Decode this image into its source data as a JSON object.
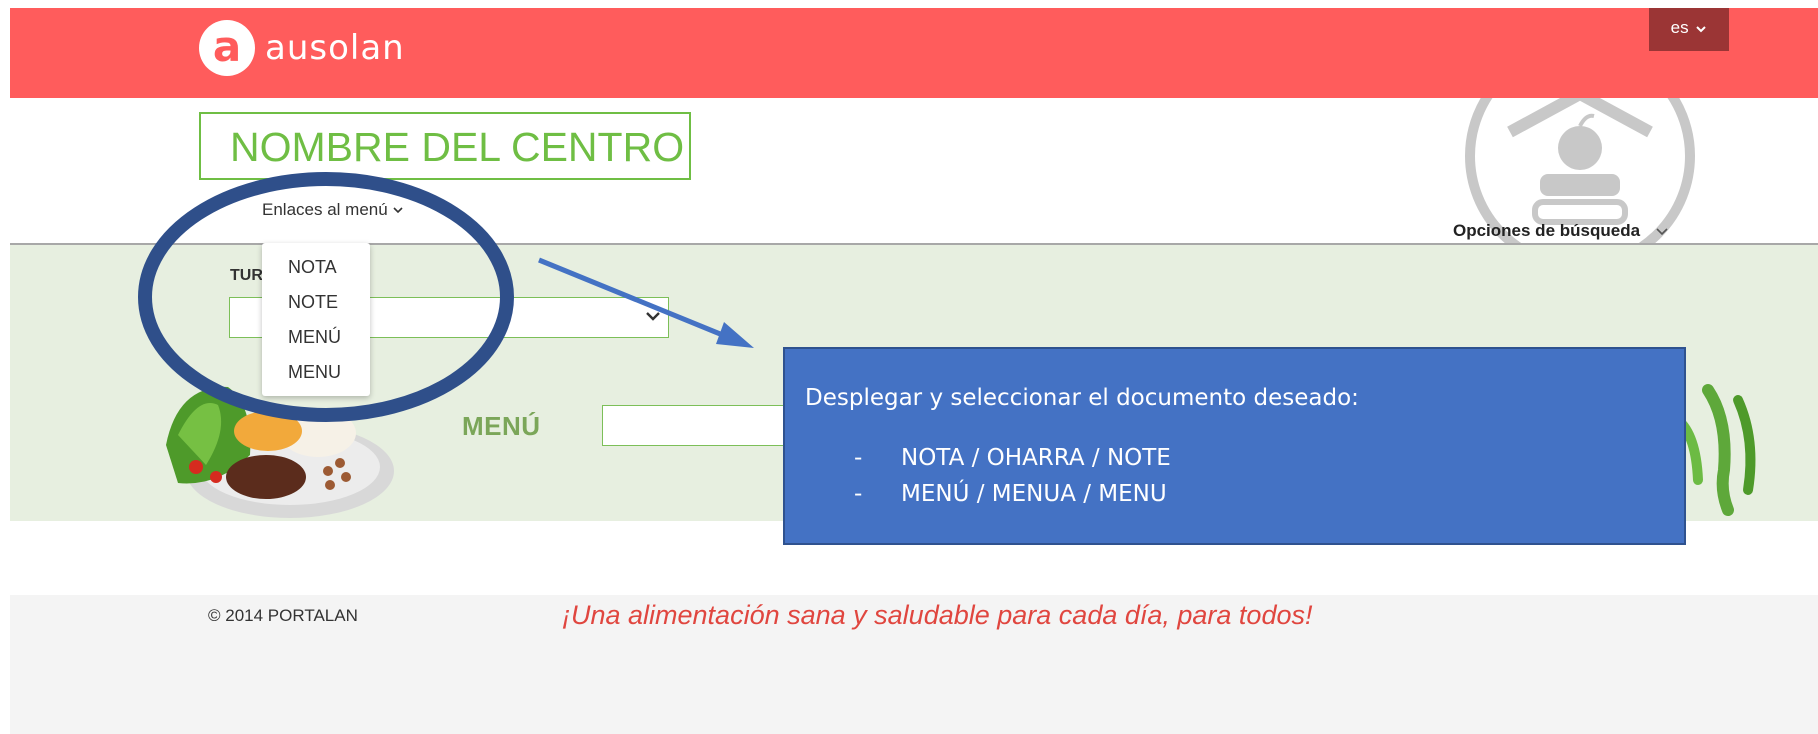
{
  "header": {
    "logo_mark": "a",
    "logo_text": "ausolan",
    "language_label": "es",
    "brand_color": "#ff5c5c"
  },
  "center": {
    "title": "NOMBRE DEL CENTRO",
    "links_label": "Enlaces al menú",
    "search_options_label": "Opciones de búsqueda"
  },
  "links_dropdown": {
    "items": [
      "NOTA",
      "NOTE",
      "MENÚ",
      "MENU"
    ]
  },
  "filters": {
    "turno_label": "TUR",
    "turno_value": "",
    "menu_label": "MENÚ",
    "menu_value": ""
  },
  "callout": {
    "title": "Desplegar y seleccionar el documento deseado:",
    "bullets": [
      "NOTA / OHARRA / NOTE",
      "MENÚ / MENUA / MENU"
    ],
    "bullet_marker": "-",
    "fill_color": "#4472c4"
  },
  "footer": {
    "copyright": "© 2014 PORTALAN",
    "slogan": "¡Una alimentación sana y saludable para cada día, para todos!"
  },
  "icons": [
    "logo-icon",
    "chevron-down-icon",
    "school-house-icon",
    "food-plate-icon",
    "peas-icon"
  ]
}
